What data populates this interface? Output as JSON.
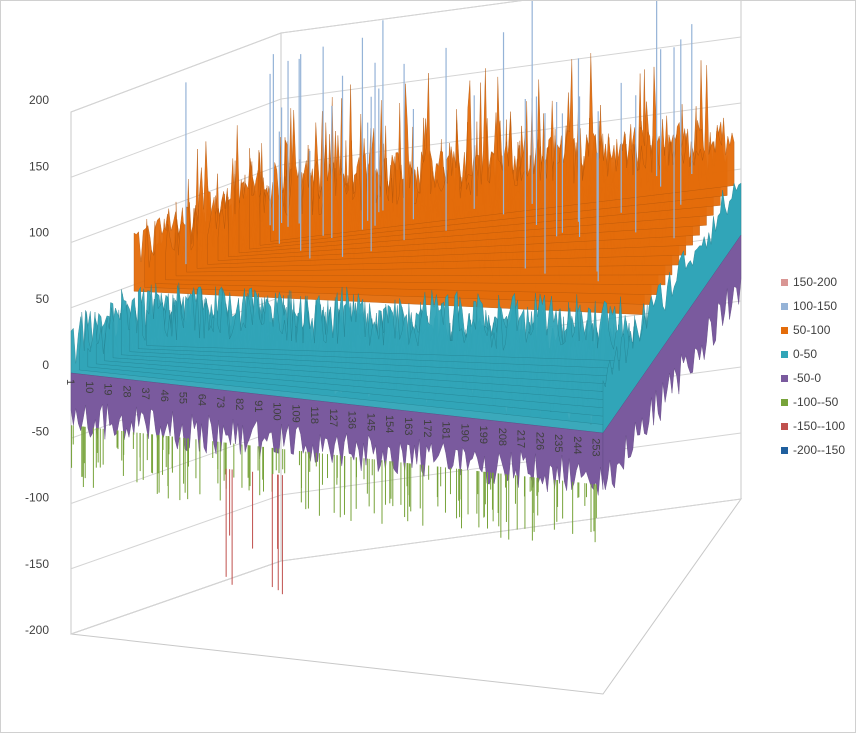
{
  "chart_data": {
    "type": "surface",
    "title": "",
    "zlim": [
      -200,
      200
    ],
    "z_ticks": [
      "200",
      "150",
      "100",
      "50",
      "0",
      "-50",
      "-100",
      "-150",
      "-200"
    ],
    "x_ticks": [
      "1",
      "10",
      "19",
      "28",
      "37",
      "46",
      "55",
      "64",
      "73",
      "82",
      "91",
      "100",
      "109",
      "118",
      "127",
      "136",
      "145",
      "154",
      "163",
      "172",
      "181",
      "190",
      "199",
      "208",
      "217",
      "226",
      "235",
      "244",
      "253"
    ],
    "x_range": [
      1,
      256
    ],
    "grid": true,
    "legend_position": "right",
    "series": [
      {
        "name": "150-200",
        "color": "#d99694"
      },
      {
        "name": "100-150",
        "color": "#95b3d7"
      },
      {
        "name": "50-100",
        "color": "#e46c0a"
      },
      {
        "name": "0-50",
        "color": "#31a5b8"
      },
      {
        "name": "-50-0",
        "color": "#7a5a9e"
      },
      {
        "name": "-100--50",
        "color": "#77a33a"
      },
      {
        "name": "-150--100",
        "color": "#c0504d"
      },
      {
        "name": "-200--150",
        "color": "#1f5f9e"
      }
    ],
    "surface_summary": {
      "typical_low": -50,
      "typical_high": 100,
      "max_spike": 215,
      "min_spike": -170
    }
  }
}
